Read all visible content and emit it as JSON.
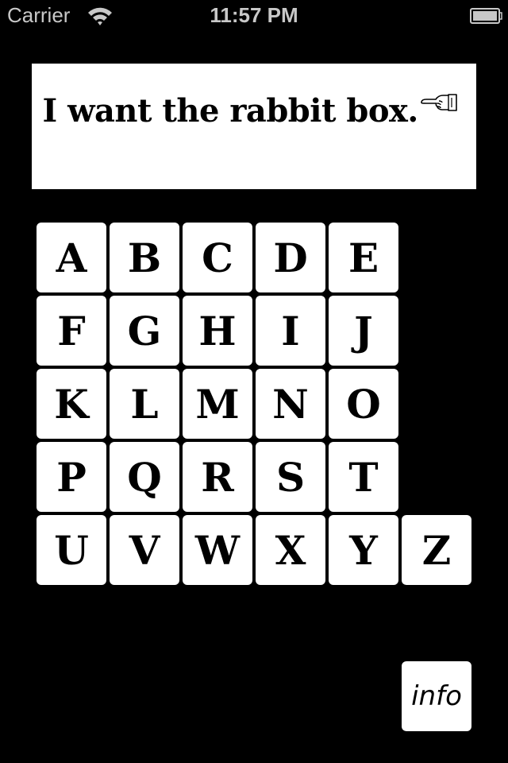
{
  "status_bar": {
    "carrier": "Carrier",
    "time": "11:57 PM",
    "wifi_icon": "wifi-icon",
    "battery_icon": "battery-full-icon"
  },
  "message": {
    "text": " I want the rabbit box.",
    "trailing_icon": "pointing-hand-icon"
  },
  "keyboard": {
    "rows": [
      [
        "A",
        "B",
        "C",
        "D",
        "E"
      ],
      [
        "F",
        "G",
        "H",
        "I",
        "J"
      ],
      [
        "K",
        "L",
        "M",
        "N",
        "O"
      ],
      [
        "P",
        "Q",
        "R",
        "S",
        "T"
      ],
      [
        "U",
        "V",
        "W",
        "X",
        "Y",
        "Z"
      ]
    ]
  },
  "info_button": {
    "label": "info"
  },
  "colors": {
    "background": "#000000",
    "tile": "#ffffff",
    "status_text": "#c8c8c8"
  }
}
